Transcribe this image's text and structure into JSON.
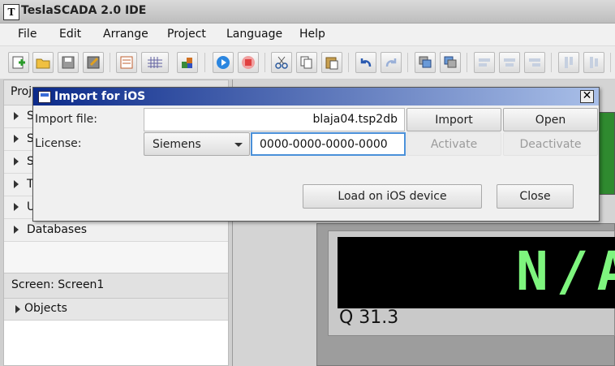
{
  "app": {
    "title": "TeslaSCADA 2.0 IDE",
    "icon_letter": "T"
  },
  "menu": [
    "File",
    "Edit",
    "Arrange",
    "Project",
    "Language",
    "Help"
  ],
  "toolbar_icons": [
    "new-icon",
    "open-folder-icon",
    "save-icon",
    "save-as-icon",
    "page-icon",
    "grid-icon",
    "export-icon",
    "run-icon",
    "stop-icon",
    "cut-icon",
    "copy-icon",
    "paste-icon",
    "undo-icon",
    "redo-icon",
    "bring-front-icon",
    "send-back-icon",
    "align-left-icon",
    "align-center-icon",
    "align-right-icon",
    "align-top-icon",
    "align-middle-icon"
  ],
  "left_panel": {
    "project_header": "Proj",
    "tree_items": [
      "S",
      "S",
      "S",
      "T",
      "U",
      "Databases"
    ],
    "screen_header": "Screen: Screen1",
    "objects_label": "Objects"
  },
  "canvas": {
    "display_value": "N/A",
    "display_label": "Q 31.3"
  },
  "dialog": {
    "title": "Import for iOS",
    "import_file_label": "Import file:",
    "import_file_value": "blaja04.tsp2db",
    "import_button": "Import",
    "open_button": "Open",
    "license_label": "License:",
    "license_vendor": "Siemens",
    "license_key": "0000-0000-0000-0000",
    "activate_button": "Activate",
    "deactivate_button": "Deactivate",
    "load_button": "Load on iOS device",
    "close_button": "Close"
  },
  "colors": {
    "dialog_title_start": "#0b2a8a",
    "display_text": "#7ef57e",
    "canvas_accent": "#2f8a2f"
  }
}
